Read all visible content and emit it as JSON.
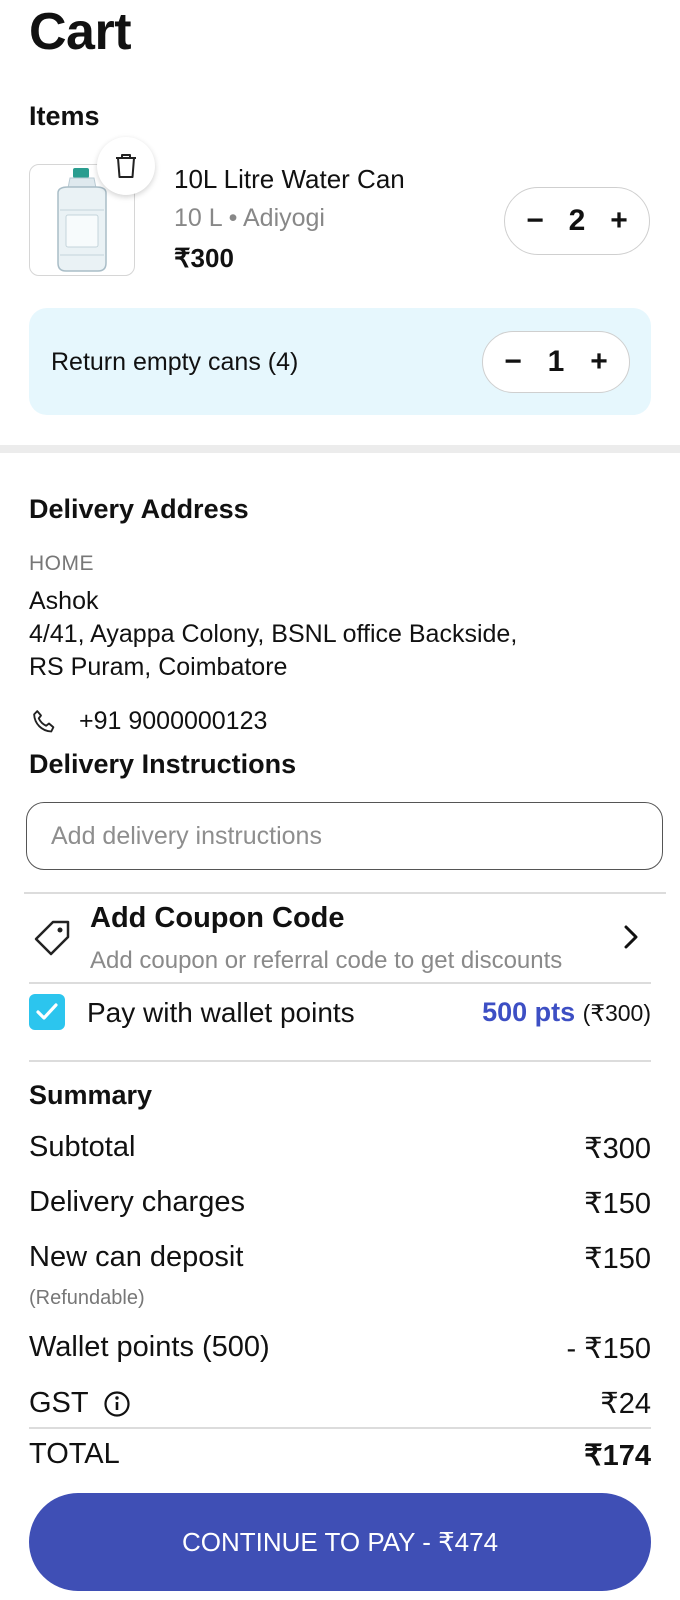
{
  "header": {
    "title": "Cart"
  },
  "items_section": {
    "title": "Items"
  },
  "product": {
    "name": "10L Litre Water Can",
    "meta": "10 L • Adiyogi",
    "price": "₹300",
    "quantity": "2",
    "decrement": "−",
    "increment": "+"
  },
  "return_cans": {
    "label": "Return empty cans (4)",
    "quantity": "1",
    "decrement": "−",
    "increment": "+"
  },
  "delivery_address": {
    "title": "Delivery Address",
    "type": "HOME",
    "name": "Ashok",
    "line1": "4/41, Ayappa Colony, BSNL office Backside,",
    "line2": "RS Puram, Coimbatore",
    "phone": "+91 9000000123"
  },
  "delivery_instructions": {
    "title": "Delivery Instructions",
    "placeholder": "Add delivery instructions",
    "value": ""
  },
  "coupon": {
    "title": "Add Coupon Code",
    "subtitle": "Add coupon or referral code to get discounts"
  },
  "wallet": {
    "checked": true,
    "label": "Pay with wallet points",
    "points": "500 pts",
    "value": "(₹300)"
  },
  "summary": {
    "title": "Summary",
    "subtotal_label": "Subtotal",
    "subtotal_value": "₹300",
    "delivery_label": "Delivery charges",
    "delivery_value": "₹150",
    "deposit_label": "New can deposit",
    "deposit_note": "(Refundable)",
    "deposit_value": "₹150",
    "wallet_label": "Wallet points (500)",
    "wallet_value": "- ₹150",
    "gst_label": "GST",
    "gst_value": "₹24",
    "total_label": "TOTAL",
    "total_value": "₹174"
  },
  "cta": {
    "label": "CONTINUE TO PAY - ₹474"
  },
  "colors": {
    "accent": "#3f4fb5",
    "points": "#3d4fc4",
    "checkbox": "#2cc5ee",
    "return_bg": "#e6f7fd"
  }
}
